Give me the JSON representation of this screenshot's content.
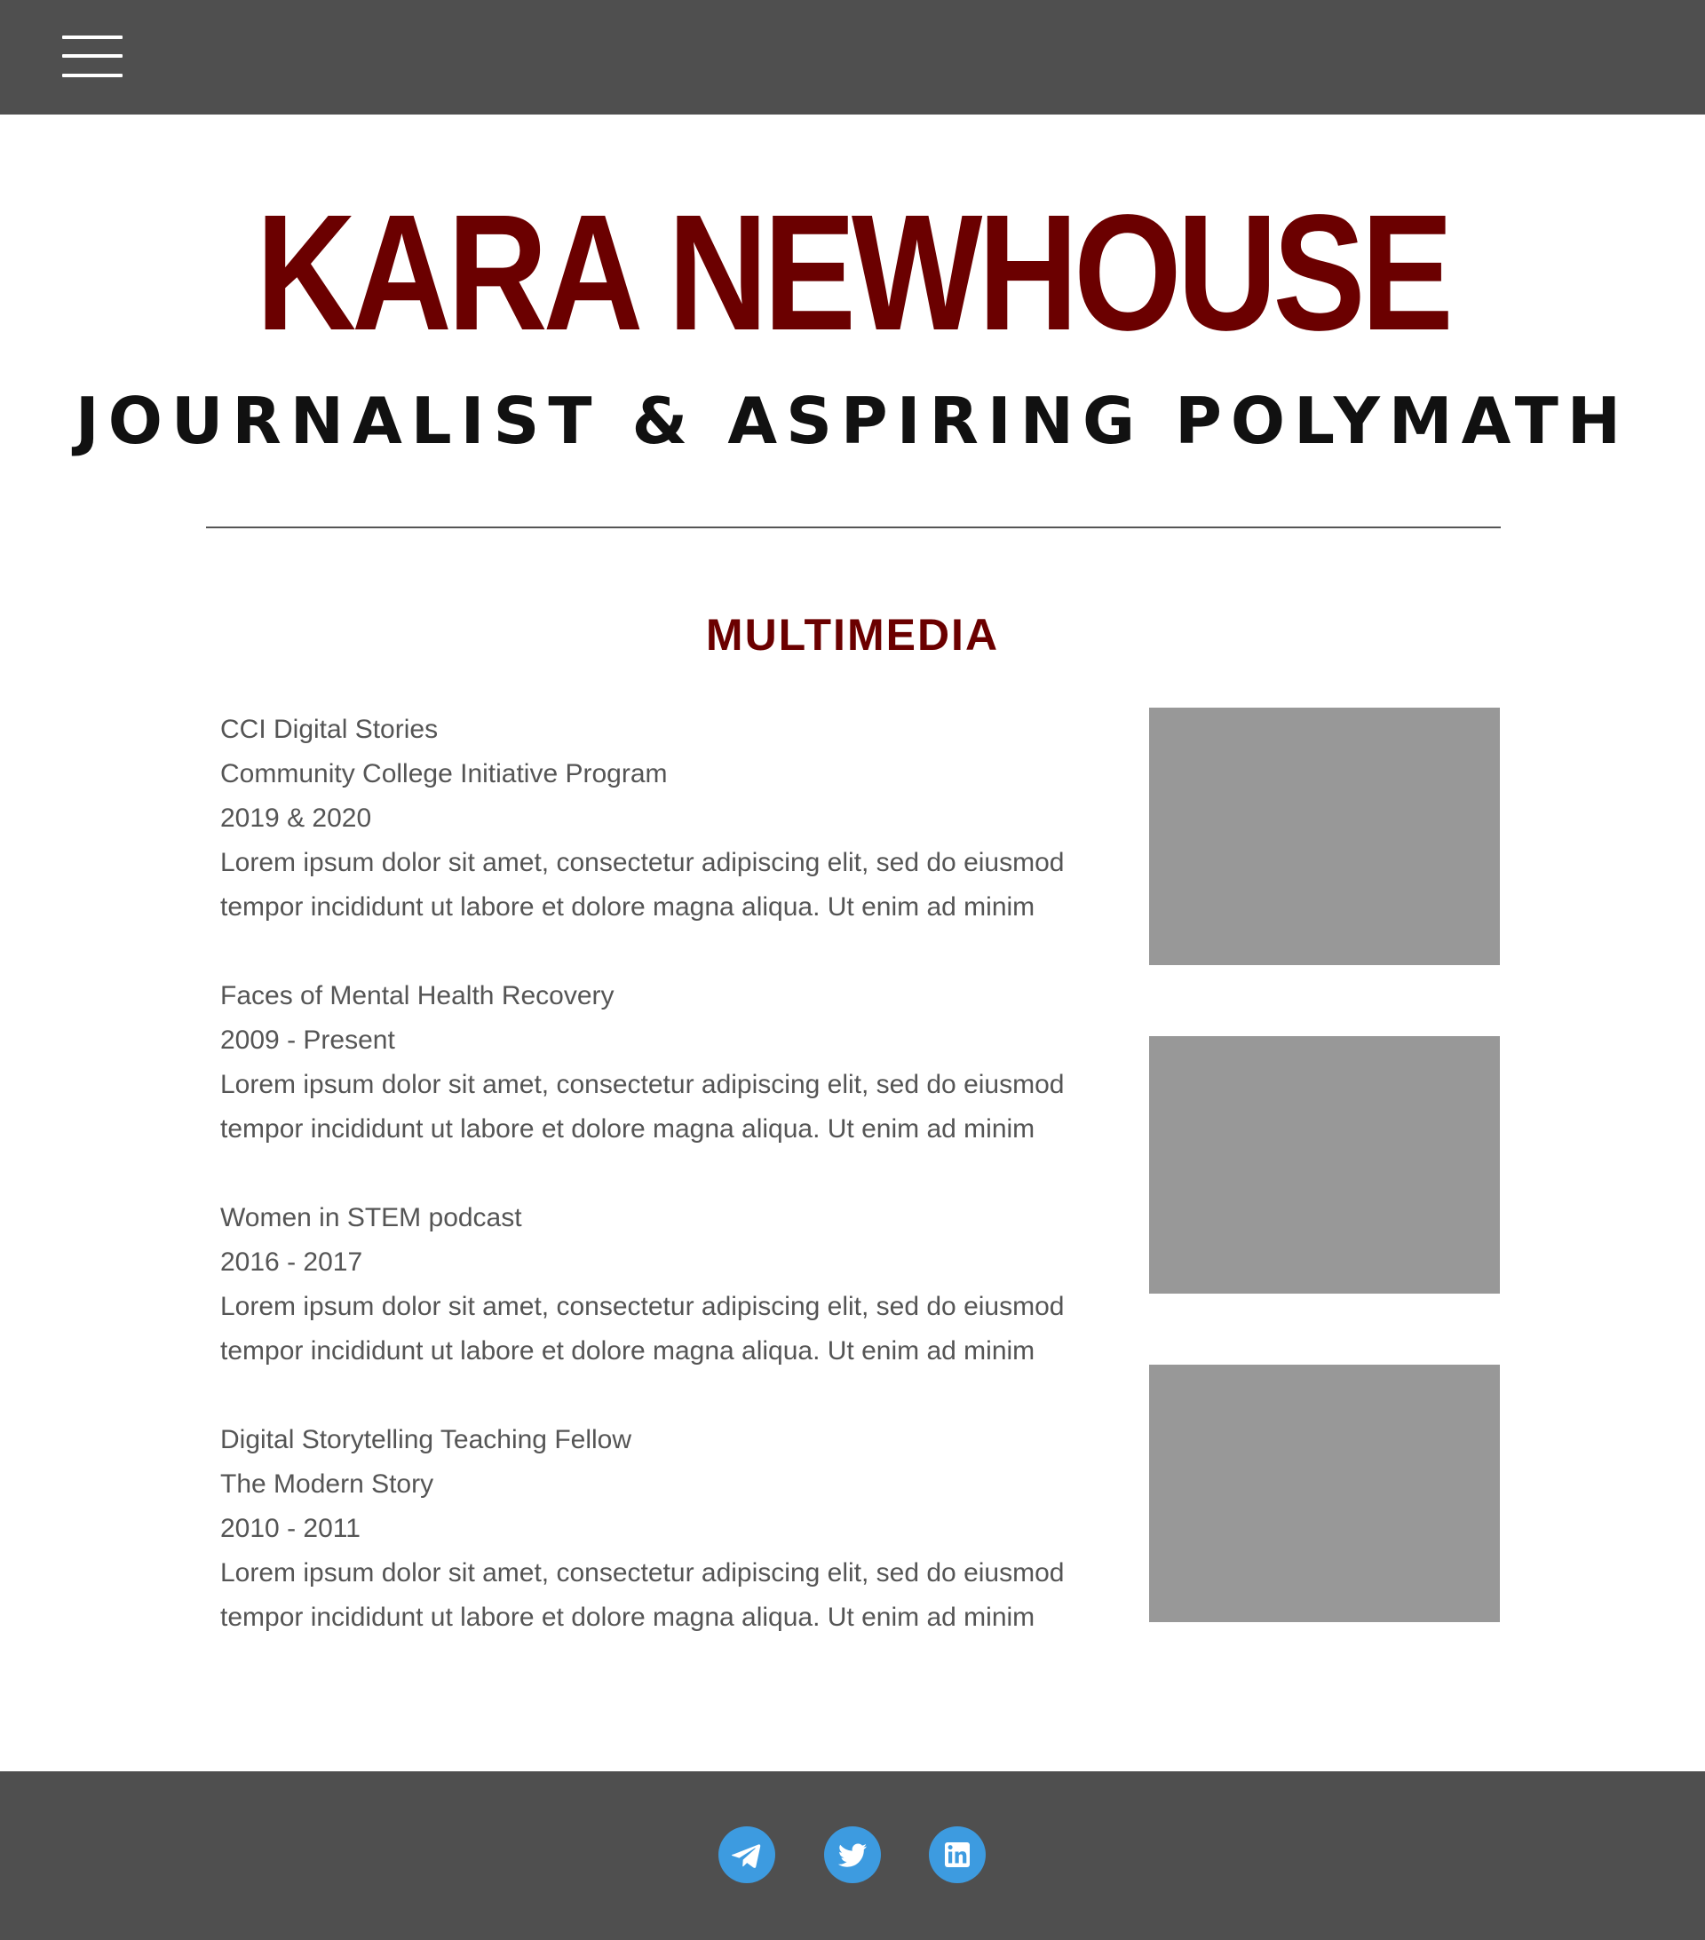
{
  "header": {
    "menu_icon": "hamburger-menu-icon"
  },
  "hero": {
    "name": "KARA NEWHOUSE",
    "tagline": "JOURNALIST & ASPIRING POLYMATH"
  },
  "section": {
    "heading": "MULTIMEDIA"
  },
  "entries": [
    {
      "lines": [
        "CCI Digital Stories",
        "Community College Initiative Program",
        "2019 & 2020"
      ],
      "description": "Lorem ipsum dolor sit amet, consectetur adipiscing elit, sed do eiusmod tempor incididunt ut labore et dolore magna aliqua. Ut enim ad minim"
    },
    {
      "lines": [
        "Faces of Mental Health Recovery",
        "2009 - Present"
      ],
      "description": "Lorem ipsum dolor sit amet, consectetur adipiscing elit, sed do eiusmod tempor incididunt ut labore et dolore magna aliqua. Ut enim ad minim"
    },
    {
      "lines": [
        "Women in STEM podcast",
        "2016 - 2017"
      ],
      "description": "Lorem ipsum dolor sit amet, consectetur adipiscing elit, sed do eiusmod tempor incididunt ut labore et dolore magna aliqua. Ut enim ad minim"
    },
    {
      "lines": [
        "Digital Storytelling Teaching Fellow",
        "The Modern Story",
        "2010 - 2011"
      ],
      "description": "Lorem ipsum dolor sit amet, consectetur adipiscing elit, sed do eiusmod tempor incididunt ut labore et dolore magna aliqua. Ut enim ad minim"
    }
  ],
  "footer": {
    "social": [
      {
        "icon": "telegram-icon"
      },
      {
        "icon": "twitter-icon"
      },
      {
        "icon": "linkedin-icon"
      }
    ]
  },
  "colors": {
    "bar_background": "#4f4f4f",
    "accent": "#6b0000",
    "image_placeholder": "#989898",
    "social_icon": "#3d9be0"
  }
}
